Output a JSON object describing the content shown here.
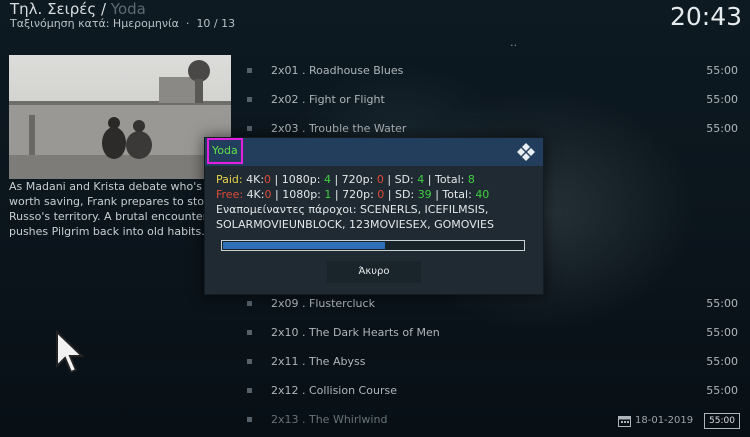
{
  "header": {
    "breadcrumb_main": "Τηλ. Σειρές /",
    "breadcrumb_sub": "Yoda",
    "sort_label": "Ταξινόμηση κατά: Ημερομηνία",
    "position": "10 / 13",
    "clock": "20:43"
  },
  "info": {
    "plot": "As Madani and Krista debate who's worth saving, Frank prepares to storm Russo's territory. A brutal encounter pushes Pilgrim back into old habits."
  },
  "list": {
    "parent": "..",
    "episodes": [
      {
        "title": "2x01 . Roadhouse Blues",
        "duration": "55:00"
      },
      {
        "title": "2x02 . Fight or Flight",
        "duration": "55:00"
      },
      {
        "title": "2x03 . Trouble the Water",
        "duration": "55:00"
      },
      {
        "title": "",
        "duration": ""
      },
      {
        "title": "",
        "duration": ""
      },
      {
        "title": "",
        "duration": ""
      },
      {
        "title": "",
        "duration": ""
      },
      {
        "title": "",
        "duration": ""
      },
      {
        "title": "2x09 . Flustercluck",
        "duration": "55:00"
      },
      {
        "title": "2x10 . The Dark Hearts of Men",
        "duration": "55:00"
      },
      {
        "title": "2x11 . The Abyss",
        "duration": "55:00"
      },
      {
        "title": "2x12 . Collision Course",
        "duration": "55:00"
      },
      {
        "title": "2x13 . The Whirlwind",
        "duration": ""
      }
    ]
  },
  "dialog": {
    "title": "Yoda",
    "icon": "kodi-icon",
    "paid_label": "Paid:",
    "free_label": "Free:",
    "k4_label": "4K:",
    "p1080_label": "1080p:",
    "p720_label": "720p:",
    "sd_label": "SD:",
    "total_label": "Total:",
    "sep": "|",
    "paid": {
      "k4": "0",
      "p1080": "4",
      "p720": "0",
      "sd": "4",
      "total": "8"
    },
    "free": {
      "k4": "0",
      "p1080": "1",
      "p720": "0",
      "sd": "39",
      "total": "40"
    },
    "remaining_line1": "Εναπομείναντες πάροχοι: SCENERLS, ICEFILMSIS,",
    "remaining_line2": "SOLARMOVIEUNBLOCK, 123MOVIESEX, GOMOVIES",
    "progress": 0.54,
    "cancel_label": "Άκυρο",
    "colors": {
      "paid": "#e8d34a",
      "free": "#e04a3a",
      "zero": "#e04a3a",
      "nonzero": "#40d040",
      "header": "#223e5c",
      "title_text": "#5fe04a",
      "highlight": "#e51fe0"
    }
  },
  "status": {
    "date": "18-01-2019",
    "duration": "55:00"
  }
}
